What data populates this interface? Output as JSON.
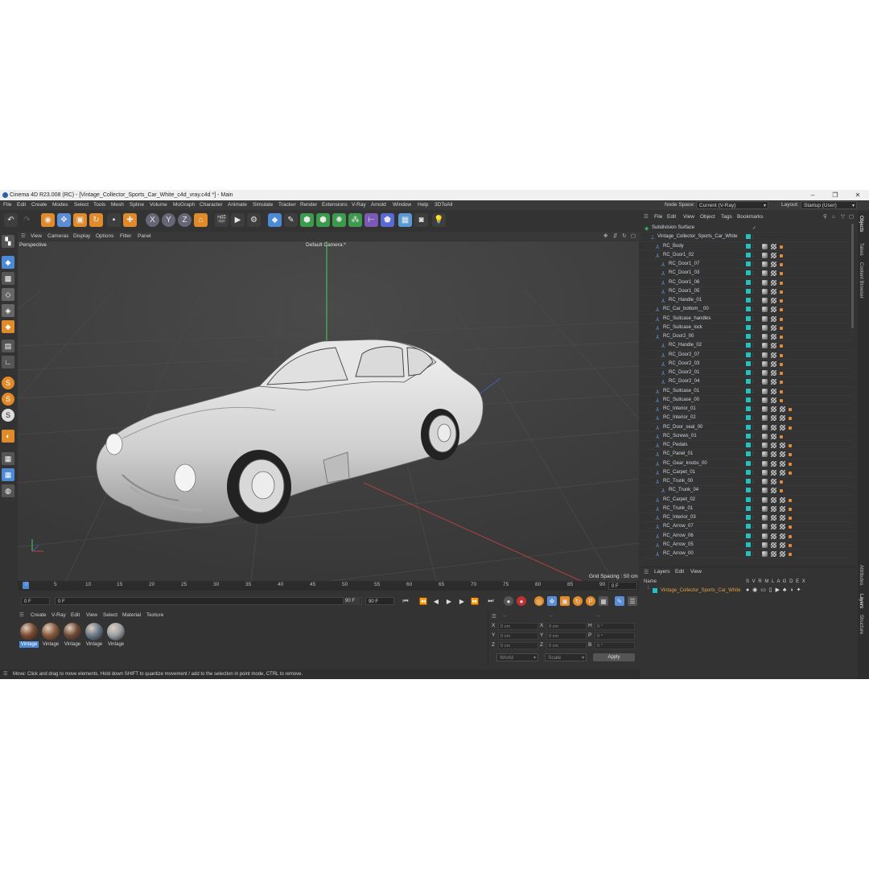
{
  "window": {
    "title": "Cinema 4D R23.008 (RC) - [Vintage_Collector_Sports_Car_White_c4d_vray.c4d *] - Main"
  },
  "menu": [
    "File",
    "Edit",
    "Create",
    "Modes",
    "Select",
    "Tools",
    "Mesh",
    "Spline",
    "Volume",
    "MoGraph",
    "Character",
    "Animate",
    "Simulate",
    "Tracker",
    "Render",
    "Extensions",
    "V-Ray",
    "Arnold",
    "Window",
    "Help",
    "3DToAll"
  ],
  "node_space": {
    "label": "Node Space:",
    "value": "Current (V-Ray)"
  },
  "layout": {
    "label": "Layout:",
    "value": "Startup (User)"
  },
  "toolbar": {
    "axis_x": "X",
    "axis_y": "Y",
    "axis_z": "Z"
  },
  "viewport_menu": [
    "View",
    "Cameras",
    "Display",
    "Options",
    "Filter",
    "Panel"
  ],
  "viewport": {
    "name": "Perspective",
    "camera": "Default Camera",
    "camera_mark": ":*",
    "grid_spacing": "Grid Spacing : 50 cm"
  },
  "timeline": {
    "ticks": [
      "0",
      "5",
      "10",
      "15",
      "20",
      "25",
      "30",
      "35",
      "40",
      "45",
      "50",
      "55",
      "60",
      "65",
      "70",
      "75",
      "80",
      "85",
      "90"
    ],
    "current_frame": "0 F"
  },
  "frames": {
    "start": "0 F",
    "current": "0 F",
    "end": "90 F",
    "end2": "90 F"
  },
  "material_menu": [
    "Create",
    "V-Ray",
    "Edit",
    "View",
    "Select",
    "Material",
    "Texture"
  ],
  "materials": [
    {
      "label": "Vintage",
      "color": "#7a4a30",
      "selected": true
    },
    {
      "label": "Vintage",
      "color": "#8a5a3c",
      "selected": false
    },
    {
      "label": "Vintage",
      "color": "#6e4a34",
      "selected": false
    },
    {
      "label": "Vintage",
      "color": "#6a7a8a",
      "selected": false
    },
    {
      "label": "Vintage",
      "color": "#9aa0a6",
      "selected": false
    }
  ],
  "coords": {
    "header": [
      "--",
      "--",
      "--"
    ],
    "rows": [
      {
        "a": "X",
        "av": "0 cm",
        "b": "X",
        "bv": "0 cm",
        "c": "H",
        "cv": "0 °"
      },
      {
        "a": "Y",
        "av": "0 cm",
        "b": "Y",
        "bv": "0 cm",
        "c": "P",
        "cv": "0 °"
      },
      {
        "a": "Z",
        "av": "0 cm",
        "b": "Z",
        "bv": "0 cm",
        "c": "B",
        "cv": "0 °"
      }
    ],
    "mode": "World",
    "scale": "Scale",
    "apply": "Apply"
  },
  "status": "Move: Click and drag to move elements. Hold down SHIFT to quantize movement / add to the selection in point mode, CTRL to remove.",
  "objects_menu": [
    "File",
    "Edit",
    "View",
    "Object",
    "Tags",
    "Bookmarks"
  ],
  "objects": [
    {
      "name": "Subdivision Surface",
      "depth": 0,
      "kind": "subd"
    },
    {
      "name": "Vintage_Collector_Sports_Car_White",
      "depth": 1,
      "kind": "null"
    },
    {
      "name": "RC_Body",
      "depth": 2,
      "kind": "obj",
      "tags": 3
    },
    {
      "name": "RC_Door1_02",
      "depth": 2,
      "kind": "obj",
      "tags": 3
    },
    {
      "name": "RC_Door1_07",
      "depth": 3,
      "kind": "obj",
      "tags": 3
    },
    {
      "name": "RC_Door1_03",
      "depth": 3,
      "kind": "obj",
      "tags": 3
    },
    {
      "name": "RC_Door1_06",
      "depth": 3,
      "kind": "obj",
      "tags": 3
    },
    {
      "name": "RC_Door1_05",
      "depth": 3,
      "kind": "obj",
      "tags": 3
    },
    {
      "name": "RC_Handle_01",
      "depth": 3,
      "kind": "obj",
      "tags": 3
    },
    {
      "name": "RC_Car_bottom__00",
      "depth": 2,
      "kind": "obj",
      "tags": 3
    },
    {
      "name": "RC_Suitcase_handles",
      "depth": 2,
      "kind": "obj",
      "tags": 3
    },
    {
      "name": "RC_Suitcase_lock",
      "depth": 2,
      "kind": "obj",
      "tags": 3
    },
    {
      "name": "RC_Door2_00",
      "depth": 2,
      "kind": "obj",
      "tags": 3
    },
    {
      "name": "RC_Handle_02",
      "depth": 3,
      "kind": "obj",
      "tags": 3
    },
    {
      "name": "RC_Door2_07",
      "depth": 3,
      "kind": "obj",
      "tags": 3
    },
    {
      "name": "RC_Door2_03",
      "depth": 3,
      "kind": "obj",
      "tags": 3
    },
    {
      "name": "RC_Door2_01",
      "depth": 3,
      "kind": "obj",
      "tags": 3
    },
    {
      "name": "RC_Door2_04",
      "depth": 3,
      "kind": "obj",
      "tags": 3
    },
    {
      "name": "RC_Suitcase_01",
      "depth": 2,
      "kind": "obj",
      "tags": 3
    },
    {
      "name": "RC_Suitcase_00",
      "depth": 2,
      "kind": "obj",
      "tags": 3
    },
    {
      "name": "RC_Interior_01",
      "depth": 2,
      "kind": "obj",
      "tags": 5
    },
    {
      "name": "RC_Interior_02",
      "depth": 2,
      "kind": "obj",
      "tags": 5
    },
    {
      "name": "RC_Door_seal_00",
      "depth": 2,
      "kind": "obj",
      "tags": 5
    },
    {
      "name": "RC_Screws_01",
      "depth": 2,
      "kind": "obj",
      "tags": 3
    },
    {
      "name": "RC_Pedals",
      "depth": 2,
      "kind": "obj",
      "tags": 5
    },
    {
      "name": "RC_Panel_01",
      "depth": 2,
      "kind": "obj",
      "tags": 5
    },
    {
      "name": "RC_Gear_knobs_00",
      "depth": 2,
      "kind": "obj",
      "tags": 5
    },
    {
      "name": "RC_Carpet_01",
      "depth": 2,
      "kind": "obj",
      "tags": 5
    },
    {
      "name": "RC_Trunk_00",
      "depth": 2,
      "kind": "obj",
      "tags": 3
    },
    {
      "name": "RC_Trunk_04",
      "depth": 3,
      "kind": "obj",
      "tags": 3
    },
    {
      "name": "RC_Carpet_02",
      "depth": 2,
      "kind": "obj",
      "tags": 5
    },
    {
      "name": "RC_Trunk_01",
      "depth": 2,
      "kind": "obj",
      "tags": 5
    },
    {
      "name": "RC_Interior_03",
      "depth": 2,
      "kind": "obj",
      "tags": 5
    },
    {
      "name": "RC_Arrow_07",
      "depth": 2,
      "kind": "obj",
      "tags": 5
    },
    {
      "name": "RC_Arrow_06",
      "depth": 2,
      "kind": "obj",
      "tags": 5
    },
    {
      "name": "RC_Arrow_05",
      "depth": 2,
      "kind": "obj",
      "tags": 5
    },
    {
      "name": "RC_Arrow_00",
      "depth": 2,
      "kind": "obj",
      "tags": 5
    }
  ],
  "layers_menu": [
    "Layers",
    "Edit",
    "View"
  ],
  "layers": {
    "col_name": "Name",
    "columns": "S V R M L A G D E X",
    "items": [
      {
        "name": "Vintage_Collector_Sports_Car_White",
        "color": "#22c2c2"
      }
    ]
  },
  "right_tabs": [
    "Objects",
    "Takes",
    "Content Browser",
    "Attributes",
    "Layers",
    "Structure"
  ]
}
